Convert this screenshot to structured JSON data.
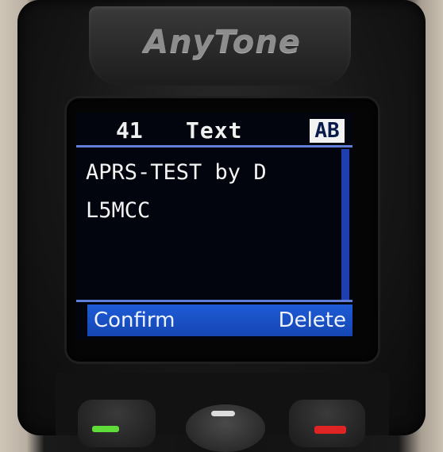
{
  "device": {
    "brand": "AnyTone"
  },
  "screen": {
    "message_number": "41",
    "title": "Text",
    "input_mode": "AB",
    "message_lines": [
      "APRS-TEST by D",
      "L5MCC"
    ],
    "softkeys": {
      "left": "Confirm",
      "right": "Delete"
    }
  },
  "colors": {
    "screen_background": "#02040e",
    "accent_blue": "#1e5bd6",
    "divider_blue": "#5f7fd8",
    "text_white": "#f4f4f4",
    "ptt_led_green": "#5fdc3a",
    "end_key_red": "#e02424"
  },
  "hardware_keys": [
    "green-call-key",
    "nav-center-key",
    "red-end-key"
  ]
}
